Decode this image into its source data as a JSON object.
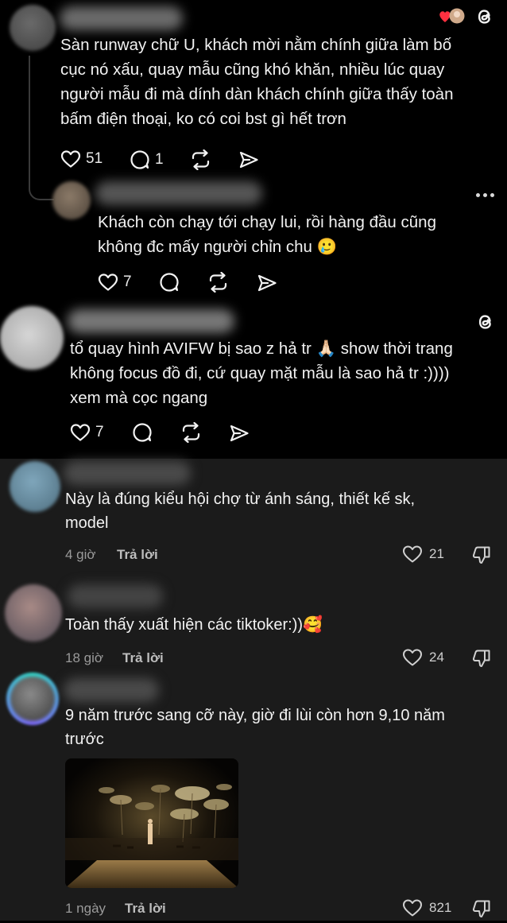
{
  "threads": {
    "post1": {
      "text_lines": [
        "Sàn runway chữ U, khách mời nằm chính giữa làm bố",
        "cục nó xấu, quay mẫu cũng khó khăn, nhiều lúc quay",
        "người mẫu đi mà dính dàn khách chính giữa thấy toàn",
        "bấm điện thoại, ko có coi bst gì hết trơn"
      ],
      "likes": "51",
      "comments": "1"
    },
    "reply1": {
      "text_lines": [
        "Khách còn chạy tới chạy lui, rồi hàng đầu cũng",
        "không đc mấy người chỉn chu 🥲"
      ],
      "likes": "7"
    },
    "post2": {
      "text_lines": [
        "tổ quay hình AVIFW bị sao z hả tr 🙏🏻 show thời trang",
        "không focus đồ đi, cứ quay mặt mẫu là sao hả tr :))))",
        "xem mà cọc ngang"
      ],
      "likes": "7"
    }
  },
  "comments": [
    {
      "text_lines": [
        "Này là đúng kiểu hội chợ từ ánh sáng, thiết kế sk,",
        "model"
      ],
      "time": "4 giờ",
      "reply_label": "Trả lời",
      "likes": "21"
    },
    {
      "text_lines": [
        "Toàn thấy xuất hiện các tiktoker:))🥰"
      ],
      "time": "18 giờ",
      "reply_label": "Trả lời",
      "likes": "24"
    },
    {
      "text_lines": [
        "9 năm trước sang cỡ này, giờ đi lùi còn hơn 9,10 năm",
        "trước"
      ],
      "time": "1 ngày",
      "reply_label": "Trả lời",
      "likes": "821"
    }
  ],
  "icons": {
    "threads_logo": "threads-logo-icon",
    "heart": "heart-icon",
    "comment": "comment-icon",
    "repost": "repost-icon",
    "share": "send-icon",
    "dislike": "dislike-icon",
    "more": "more-icon"
  }
}
